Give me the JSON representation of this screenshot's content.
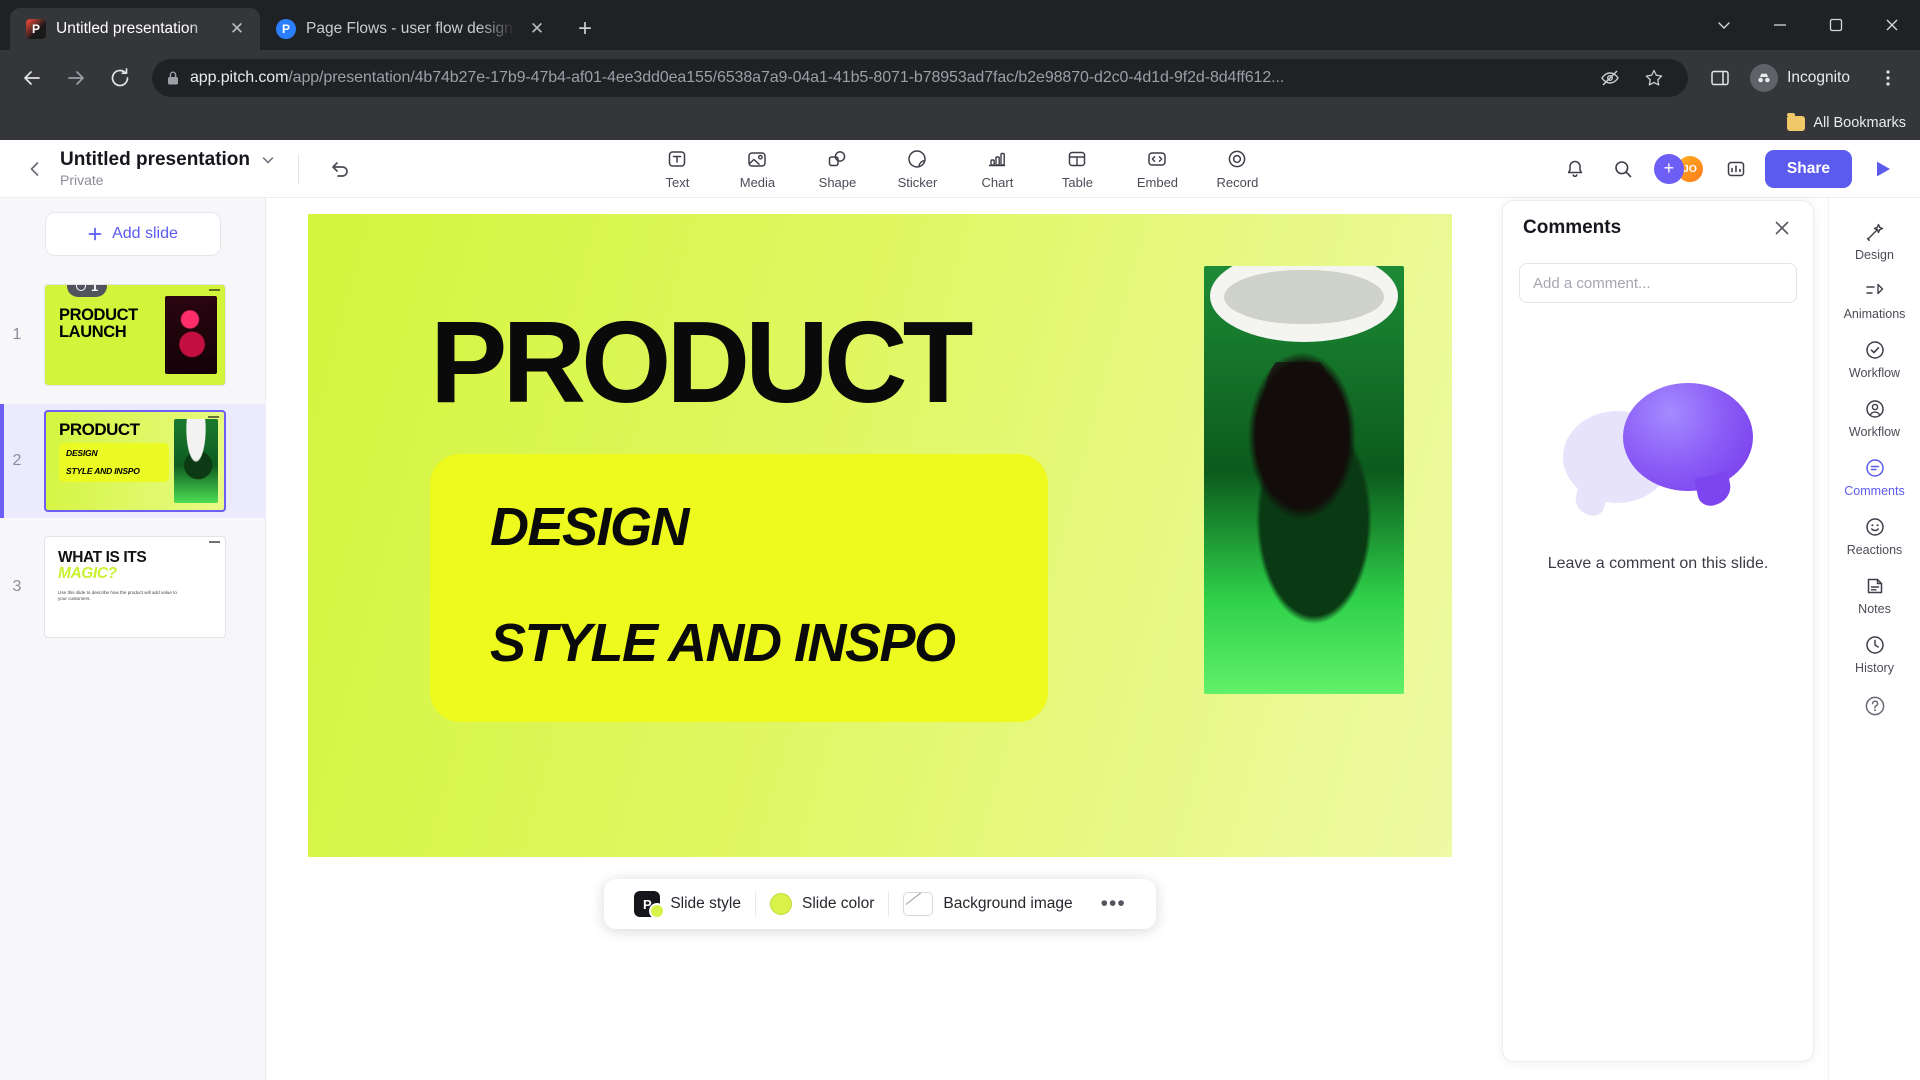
{
  "browser": {
    "tabs": [
      {
        "title": "Untitled presentation",
        "favicon": "pitch-logo-icon",
        "active": true
      },
      {
        "title": "Page Flows - user flow design in",
        "favicon": "pitch-blue-icon",
        "active": false
      }
    ],
    "new_tab_label": "+",
    "window_controls": {
      "minimize": "—",
      "maximize": "❐",
      "close": "✕",
      "chevron": "⌄"
    },
    "nav": {
      "back": "←",
      "forward": "→",
      "reload": "↻"
    },
    "url": {
      "host": "app.pitch.com",
      "path": "/app/presentation/4b74b27e-17b9-47b4-af01-4ee3dd0ea155/6538a7a9-04a1-41b5-8071-b78953ad7fac/b2e98870-d2c0-4d1d-9f2d-8d4ff612...",
      "lock_icon": "lock-icon"
    },
    "profile": {
      "label": "Incognito",
      "icon": "incognito-icon"
    },
    "bookmarks": {
      "label": "All Bookmarks",
      "icon": "folder-icon"
    }
  },
  "app_header": {
    "back_icon": "chevron-left-icon",
    "doc_title": "Untitled presentation",
    "doc_privacy": "Private",
    "title_chevron": "chevron-down-icon",
    "undo_icon": "undo-arrow-icon",
    "tools": [
      {
        "label": "Text",
        "icon": "text-box-icon"
      },
      {
        "label": "Media",
        "icon": "image-icon"
      },
      {
        "label": "Shape",
        "icon": "shape-icon"
      },
      {
        "label": "Sticker",
        "icon": "sticker-icon"
      },
      {
        "label": "Chart",
        "icon": "bar-chart-icon"
      },
      {
        "label": "Table",
        "icon": "table-grid-icon"
      },
      {
        "label": "Embed",
        "icon": "code-embed-icon"
      },
      {
        "label": "Record",
        "icon": "record-circle-icon"
      }
    ],
    "notification_icon": "bell-icon",
    "search_icon": "search-icon",
    "invite_plus": "+",
    "avatar_initials": "JO",
    "analytics_icon": "analytics-icon",
    "share_label": "Share",
    "present_icon": "play-icon"
  },
  "slides_panel": {
    "add_slide_label": "Add slide",
    "add_slide_icon": "plus-icon",
    "slides": [
      {
        "number": "1",
        "comment_count": "1",
        "title_line1": "PRODUCT",
        "title_line2": "LAUNCH",
        "selected": false
      },
      {
        "number": "2",
        "title": "PRODUCT",
        "sub1": "DESIGN",
        "sub2": "STYLE AND INSPO",
        "selected": true
      },
      {
        "number": "3",
        "title_line1": "WHAT IS ITS",
        "title_line2": "MAGIC?",
        "body": "Use this slide to describe how the product will add value to your customers.",
        "selected": false
      }
    ]
  },
  "slide": {
    "heading": "PRODUCT",
    "card_line1": "DESIGN",
    "card_line2": "STYLE AND INSPO",
    "photo_alt": "model-in-green-dress-photo"
  },
  "slide_toolbar": {
    "style_label": "Slide style",
    "style_icon": "pitch-badge-icon",
    "color_label": "Slide color",
    "color_swatch": "#d9f24a",
    "background_label": "Background image",
    "background_icon": "no-image-icon",
    "more_label": "•••"
  },
  "comments_panel": {
    "title": "Comments",
    "close_icon": "close-icon",
    "input_placeholder": "Add a comment...",
    "empty_text": "Leave a comment on this slide.",
    "illustration": "speech-bubbles-illustration"
  },
  "right_rail": {
    "items": [
      {
        "label": "Design",
        "icon": "design-wand-icon",
        "active": false
      },
      {
        "label": "Animations",
        "icon": "animations-icon",
        "active": false
      },
      {
        "label": "Workflow",
        "icon": "workflow-icon",
        "active": false
      },
      {
        "label": "Comments",
        "icon": "comment-icon",
        "active": true
      },
      {
        "label": "Reactions",
        "icon": "smiley-icon",
        "active": false
      },
      {
        "label": "Notes",
        "icon": "notes-icon",
        "active": false
      },
      {
        "label": "History",
        "icon": "history-clock-icon",
        "active": false
      }
    ],
    "help_icon": "help-question-icon"
  },
  "colors": {
    "accent": "#5b5bf0",
    "slide_green": "#d3f53d",
    "slide_yellow": "#eefa1e",
    "purple_bubble": "#8b5cf6"
  }
}
